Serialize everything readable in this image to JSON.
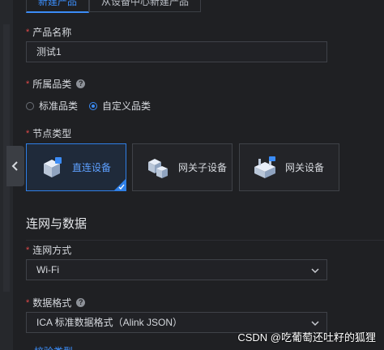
{
  "tabs": [
    {
      "label": "新建产品",
      "active": true
    },
    {
      "label": "从设备中心新建产品",
      "active": false
    }
  ],
  "form": {
    "product_name": {
      "label": "产品名称",
      "value": "测试1"
    },
    "category": {
      "label": "所属品类",
      "help": "?",
      "options": [
        {
          "label": "标准品类",
          "checked": false
        },
        {
          "label": "自定义品类",
          "checked": true
        }
      ]
    },
    "node_type": {
      "label": "节点类型",
      "options": [
        {
          "label": "直连设备",
          "selected": true,
          "icon": "direct-device-icon"
        },
        {
          "label": "网关子设备",
          "selected": false,
          "icon": "gateway-sub-device-icon"
        },
        {
          "label": "网关设备",
          "selected": false,
          "icon": "gateway-device-icon"
        }
      ]
    },
    "section_network": "连网与数据",
    "network_method": {
      "label": "连网方式",
      "value": "Wi-Fi"
    },
    "data_format": {
      "label": "数据格式",
      "help": "?",
      "value": "ICA 标准数据格式（Alink JSON）"
    },
    "next_label_partial": "校验类型"
  },
  "required_mark": "*",
  "watermark": "CSDN @吃葡萄还吐籽的狐狸",
  "colors": {
    "accent": "#3b8cf7",
    "required": "#e34a4a",
    "background": "#1f2023"
  }
}
